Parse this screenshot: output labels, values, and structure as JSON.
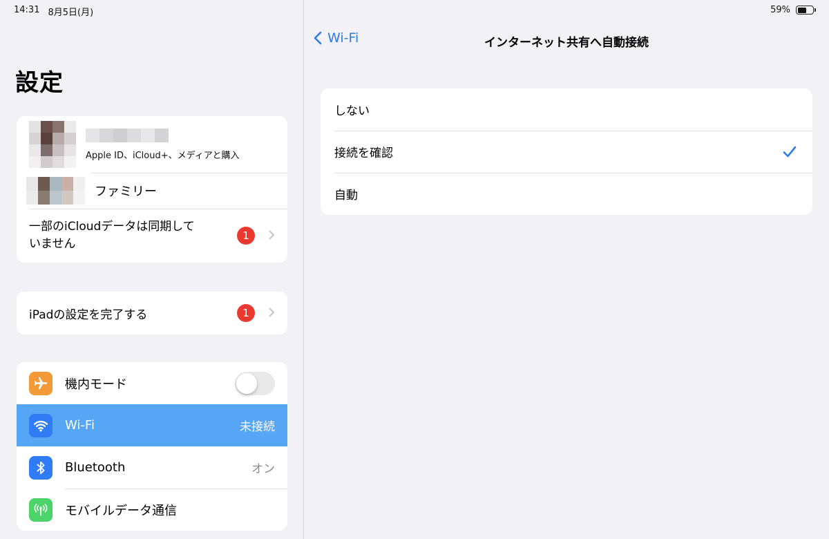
{
  "status_bar": {
    "time": "14:31",
    "date": "8月5日(月)",
    "battery": "59%",
    "battery_level": 0.59
  },
  "sidebar": {
    "title": "設定",
    "profile": {
      "subtitle": "Apple ID、iCloud+、メディアと購入"
    },
    "family": {
      "label": "ファミリー"
    },
    "icloud_sync": {
      "label_line1": "一部のiCloudデータは同期して",
      "label_line2": "いません",
      "badge": "1"
    },
    "ipad_setup": {
      "label": "iPadの設定を完了する",
      "badge": "1"
    },
    "settings": [
      {
        "label": "機内モード",
        "icon": "airplane-icon",
        "icon_color": "#f19a37",
        "toggle": false
      },
      {
        "label": "Wi-Fi",
        "icon": "wifi-icon",
        "icon_color": "#2f7cf6",
        "value": "未接続",
        "selected": true
      },
      {
        "label": "Bluetooth",
        "icon": "bluetooth-icon",
        "icon_color": "#2f7cf6",
        "value": "オン"
      },
      {
        "label": "モバイルデータ通信",
        "icon": "antenna-icon",
        "icon_color": "#4cd36a"
      }
    ]
  },
  "detail": {
    "back_label": "Wi-Fi",
    "title": "インターネット共有へ自動接続",
    "options": [
      {
        "label": "しない",
        "checked": false
      },
      {
        "label": "接続を確認",
        "checked": true
      },
      {
        "label": "自動",
        "checked": false
      }
    ],
    "accent_color": "#2f7be0"
  }
}
